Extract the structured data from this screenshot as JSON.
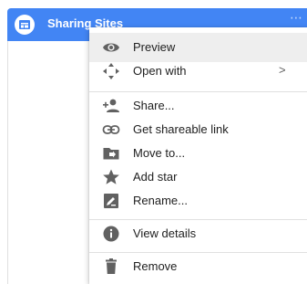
{
  "file": {
    "name": "Sharing Sites",
    "more_glyph": "⋯"
  },
  "menu": {
    "items": [
      {
        "label": "Preview",
        "icon": "eye-icon"
      },
      {
        "label": "Open with",
        "icon": "move-arrows-icon",
        "submenu_glyph": ">"
      },
      {
        "label": "Share...",
        "icon": "person-add-icon"
      },
      {
        "label": "Get shareable link",
        "icon": "link-icon"
      },
      {
        "label": "Move to...",
        "icon": "folder-move-icon"
      },
      {
        "label": "Add star",
        "icon": "star-icon"
      },
      {
        "label": "Rename...",
        "icon": "rename-icon"
      },
      {
        "label": "View details",
        "icon": "info-icon"
      },
      {
        "label": "Remove",
        "icon": "trash-icon"
      }
    ]
  },
  "colors": {
    "chip": "#4285f4",
    "icon": "#616161",
    "hover": "#eeeeee"
  }
}
